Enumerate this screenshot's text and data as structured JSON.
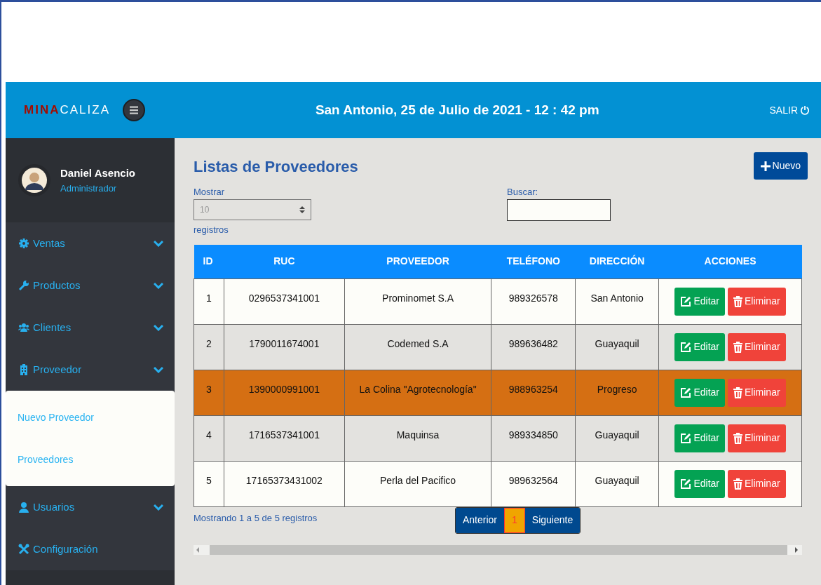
{
  "header": {
    "logo_parts": [
      {
        "text": "MINA",
        "kind": "accent"
      },
      {
        "text": "CALIZA",
        "kind": "plain"
      }
    ],
    "datetime": "San Antonio, 25 de Julio de 2021 - 12 : 42 pm",
    "logout": "SALIR"
  },
  "user": {
    "name": "Daniel Asencio",
    "role": "Administrador"
  },
  "sidebar": {
    "items": [
      {
        "label": "Ventas",
        "kind": "gear",
        "expandable": true,
        "expanded": false
      },
      {
        "label": "Productos",
        "kind": "wrench",
        "expandable": true,
        "expanded": false
      },
      {
        "label": "Clientes",
        "kind": "users",
        "expandable": true,
        "expanded": false
      },
      {
        "label": "Proveedor",
        "kind": "building",
        "expandable": true,
        "expanded": true,
        "children": [
          {
            "label": "Nuevo Proveedor"
          },
          {
            "label": "Proveedores"
          }
        ]
      },
      {
        "label": "Usuarios",
        "kind": "user",
        "expandable": true,
        "expanded": false
      },
      {
        "label": "Configuración",
        "kind": "tools",
        "expandable": false
      }
    ]
  },
  "page": {
    "title": "Listas de Proveedores",
    "new_button": "Nuevo",
    "length": {
      "label": "Mostrar",
      "value": "10",
      "suffix": "registros"
    },
    "search": {
      "label": "Buscar:"
    },
    "table": {
      "columns": [
        "ID",
        "RUC",
        "PROVEEDOR",
        "TELÉFONO",
        "DIRECCIÓN",
        "ACCIONES"
      ],
      "rows": [
        {
          "cells": [
            "1",
            "0296537341001",
            "Prominomet S.A",
            "989326578",
            "San Antonio"
          ],
          "selected": false,
          "actions": [
            {
              "label": "Editar",
              "kind": "edit"
            },
            {
              "label": "Eliminar",
              "kind": "delete"
            }
          ]
        },
        {
          "cells": [
            "2",
            "1790011674001",
            "Codemed S.A",
            "989636482",
            "Guayaquil"
          ],
          "selected": false,
          "actions": [
            {
              "label": "Editar",
              "kind": "edit"
            },
            {
              "label": "Eliminar",
              "kind": "delete"
            }
          ]
        },
        {
          "cells": [
            "3",
            "1390000991001",
            "La Colina \"Agrotecnología\"",
            "988963254",
            "Progreso"
          ],
          "selected": true,
          "actions": [
            {
              "label": "Editar",
              "kind": "edit"
            },
            {
              "label": "Eliminar",
              "kind": "delete"
            }
          ]
        },
        {
          "cells": [
            "4",
            "1716537341001",
            "Maquinsa",
            "989334850",
            "Guayaquil"
          ],
          "selected": false,
          "actions": [
            {
              "label": "Editar",
              "kind": "edit"
            },
            {
              "label": "Eliminar",
              "kind": "delete"
            }
          ]
        },
        {
          "cells": [
            "5",
            "17165373431002",
            "Perla del Pacifico",
            "989632564",
            "Guayaquil"
          ],
          "selected": false,
          "actions": [
            {
              "label": "Editar",
              "kind": "edit"
            },
            {
              "label": "Eliminar",
              "kind": "delete"
            }
          ]
        }
      ]
    },
    "info": "Mostrando 1 a 5 de 5 registros",
    "pagination": [
      {
        "label": "Anterior",
        "selected": false
      },
      {
        "label": "1",
        "selected": true
      },
      {
        "label": "Siguiente",
        "selected": false
      }
    ]
  }
}
